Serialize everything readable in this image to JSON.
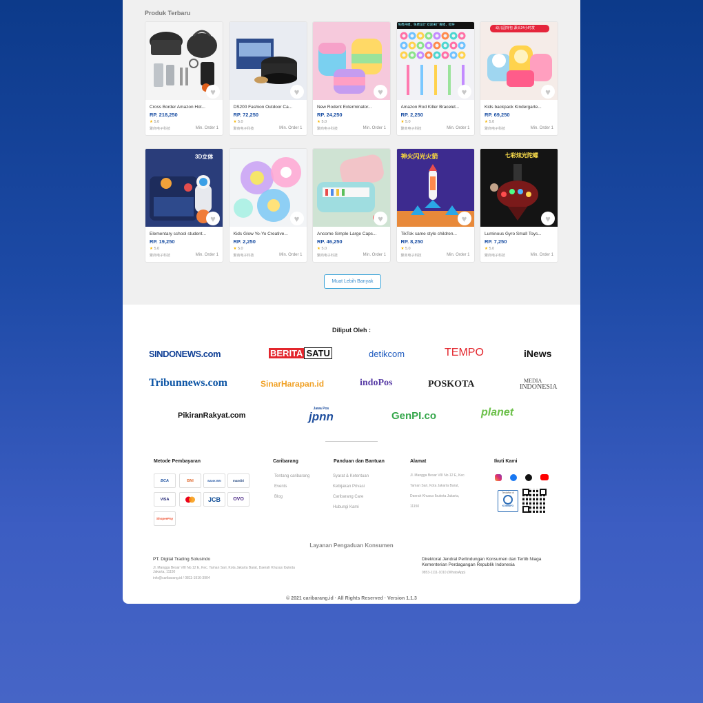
{
  "section_title": "Produk Terbaru",
  "products": [
    {
      "name": "Cross Border Amazon Hot...",
      "price": "RP. 218,250",
      "rating": "5.0",
      "seller": "聚商电子科技",
      "min_order": "Min. Order 1",
      "bg": "#f4f4f4"
    },
    {
      "name": "DS200 Fashion Outdoor Ca...",
      "price": "RP. 72,250",
      "rating": "5.0",
      "seller": "聚商电子科技",
      "min_order": "Min. Order 1",
      "bg": "#e9ecf2"
    },
    {
      "name": "New Rodent Exterminator...",
      "price": "RP. 24,250",
      "rating": "5.0",
      "seller": "聚商电子科技",
      "min_order": "Min. Order 1",
      "bg": "#f6c9dc"
    },
    {
      "name": "Amazon Rod Killer Bracelet...",
      "price": "RP. 2,250",
      "rating": "5.0",
      "seller": "聚商电子科技",
      "min_order": "Min. Order 1",
      "bg": "#f2f2f6"
    },
    {
      "name": "Kids backpack Kindergarte...",
      "price": "RP. 69,250",
      "rating": "5.0",
      "seller": "聚商电子科技",
      "min_order": "Min. Order 1",
      "bg": "#f5ece8"
    },
    {
      "name": "Elementary school student...",
      "price": "RP. 19,250",
      "rating": "5.0",
      "seller": "聚商电子科技",
      "min_order": "Min. Order 1",
      "bg": "#2a3d7a"
    },
    {
      "name": "Kids Glow Yo-Yo Creative...",
      "price": "RP. 2,250",
      "rating": "5.0",
      "seller": "聚商电子科技",
      "min_order": "Min. Order 1",
      "bg": "#f2f4f6"
    },
    {
      "name": "Ancome Simple Large Caps...",
      "price": "RP. 46,250",
      "rating": "5.0",
      "seller": "聚商电子科技",
      "min_order": "Min. Order 1",
      "bg": "#cfe3d3"
    },
    {
      "name": "TikTok same style children...",
      "price": "RP. 8,250",
      "rating": "5.0",
      "seller": "聚商电子科技",
      "min_order": "Min. Order 1",
      "bg": "#3a2a86"
    },
    {
      "name": "Luminous Gyro Small Toys...",
      "price": "RP. 7,250",
      "rating": "5.0",
      "seller": "聚商电子科技",
      "min_order": "Min. Order 1",
      "bg": "#1a1a1a"
    }
  ],
  "thumb_texts": {
    "p4_top": "免费开模，免费设计 欢迎来厂看模，指导",
    "p5_top": "幼儿园背包 源头24小时发",
    "p6_top": "3D立体",
    "p9_top": "神火闪光火箭",
    "p10_top": "七彩炫光陀螺"
  },
  "load_more": "Muat Lebih Banyak",
  "press_title": "Diliput Oleh :",
  "press_logos": {
    "sindonews": "SINDONEWS.com",
    "beritasatu_a": "BERITA",
    "beritasatu_b": "SATU",
    "detik": "detikcom",
    "tempo": "TEMPO",
    "inews": "iNews",
    "tribun": "Tribunnews.com",
    "sinarharapan": "SinarHarapan.id",
    "indopos": "indoPos",
    "poskota": "POSKOTA",
    "mediaindonesia_a": "MEDIA",
    "mediaindonesia_b": "INDONESIA",
    "pikiranrakyat": "PikiranRakyat.com",
    "jpnn": "jpnn",
    "jpnn_sub": "Jawa Pos",
    "genpi": "GenPI.co",
    "planet": "planet"
  },
  "footer": {
    "payment_title": "Metode Pembayaran",
    "payments": [
      "BCA",
      "BNI",
      "BANK BRI",
      "mandiri",
      "VISA",
      "mastercard",
      "JCB",
      "OVO",
      "ShopeePay"
    ],
    "caribarang_title": "Caribarang",
    "caribarang_links": [
      "Tentang caribarang",
      "Events",
      "Blog"
    ],
    "guide_title": "Panduan dan Bantuan",
    "guide_links": [
      "Syarat & Ketentuan",
      "Kebijakan Privasi",
      "Caribarang Care",
      "Hubungi Kami"
    ],
    "address_title": "Alamat",
    "address": "Jl. Mangga Besar VIII No.12 E, Kec. Taman Sari, Kota Jakarta Barat, Daerah Khusus Ibukota Jakarta, 11150",
    "follow_title": "Ikuti Kami",
    "kominfo_label": "Terdaftar di",
    "kominfo_name": "KOMINFO"
  },
  "service": {
    "title": "Layanan Pengaduan Konsumen",
    "company": "PT. Digital Trading Solusindo",
    "company_addr": "Jl. Mangga Besar VIII No.12 E, Kec. Taman Sari, Kota Jakarta Barat, Daerah Khusus Ibukota Jakarta, 11150",
    "company_contact": "info@caribarang.id / 0811-1916-3904",
    "gov_line1": "Direktorat Jendral Perlindungan Konsumen dan Tertib Niaga",
    "gov_line2": "Kementerian Perdagangan Republik Indonesia",
    "gov_contact": "0853-1111-1010 (WhatsApp)"
  },
  "copyright": "© 2021 caribarang.id · All Rights Reserved · Version 1.1.3",
  "colors": {
    "price": "#1b4fa3",
    "accent": "#3aa3d8",
    "star": "#f5b400"
  }
}
